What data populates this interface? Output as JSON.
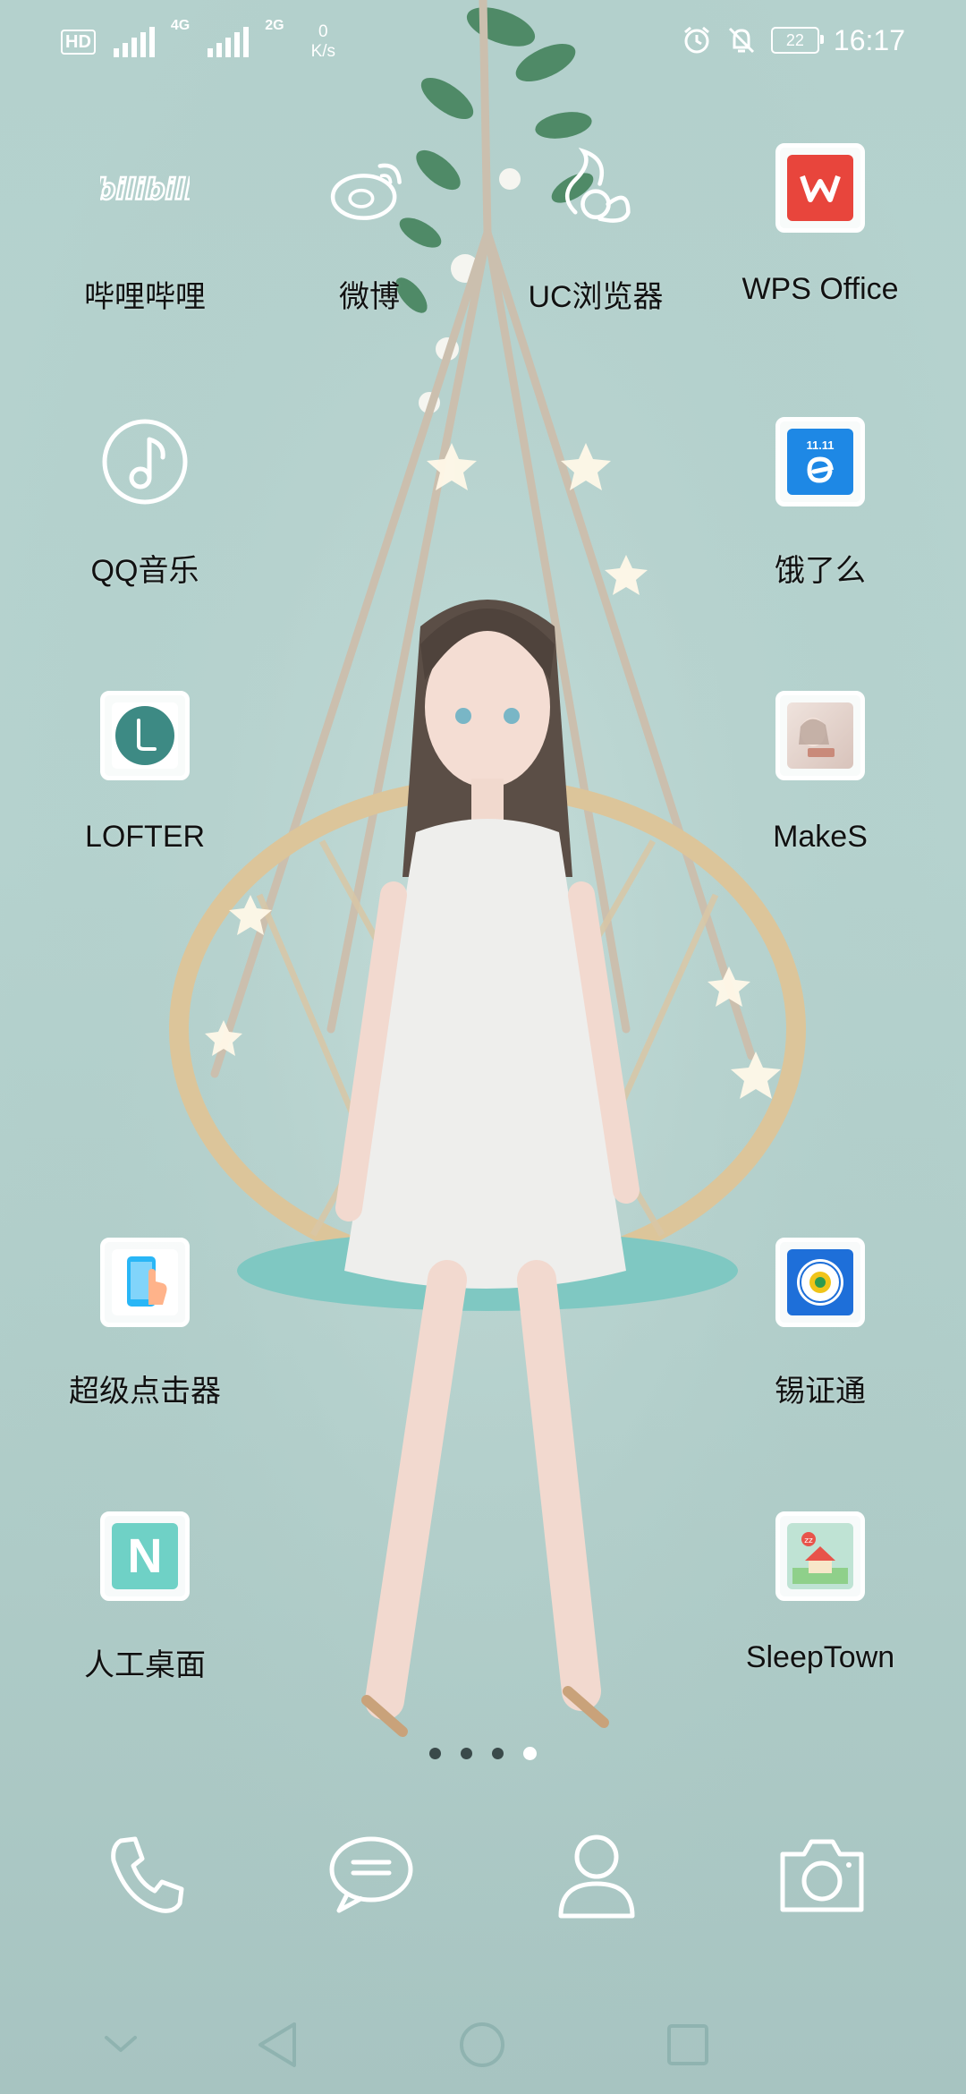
{
  "status_bar": {
    "hd": "HD",
    "sim1": "1",
    "net1": "4G",
    "net2": "2G",
    "speed_value": "0",
    "speed_unit": "K/s",
    "battery": "22",
    "time": "16:17"
  },
  "apps": [
    {
      "label": "哔哩哔哩",
      "icon": "bilibili-icon"
    },
    {
      "label": "微博",
      "icon": "weibo-icon"
    },
    {
      "label": "UC浏览器",
      "icon": "uc-browser-icon"
    },
    {
      "label": "WPS Office",
      "icon": "wps-office-icon",
      "color": "#e8453c"
    },
    {
      "label": "QQ音乐",
      "icon": "qq-music-icon"
    },
    {
      "label": "饿了么",
      "icon": "eleme-icon",
      "color": "#1e88e5",
      "badge": "11.11"
    },
    {
      "label": "LOFTER",
      "icon": "lofter-icon",
      "color": "#3d8a84"
    },
    {
      "label": "MakeS",
      "icon": "makes-icon",
      "color": "#e9d6cf"
    },
    {
      "label": "超级点击器",
      "icon": "super-clicker-icon",
      "color": "#29b6f6"
    },
    {
      "label": "锡证通",
      "icon": "xizhengtong-icon",
      "color": "#1e6fd9"
    },
    {
      "label": "人工桌面",
      "icon": "artificial-desktop-icon",
      "color": "#6fd1c6",
      "letter": "N"
    },
    {
      "label": "SleepTown",
      "icon": "sleeptown-icon",
      "color": "#bfe3d4",
      "badge": "zz"
    }
  ],
  "page_indicator": {
    "count": 4,
    "active_index": 3
  },
  "dock": [
    "phone-icon",
    "messages-icon",
    "contacts-icon",
    "camera-icon"
  ],
  "nav_bar": [
    "hide-nav-icon",
    "back-icon",
    "home-icon",
    "recents-icon"
  ]
}
